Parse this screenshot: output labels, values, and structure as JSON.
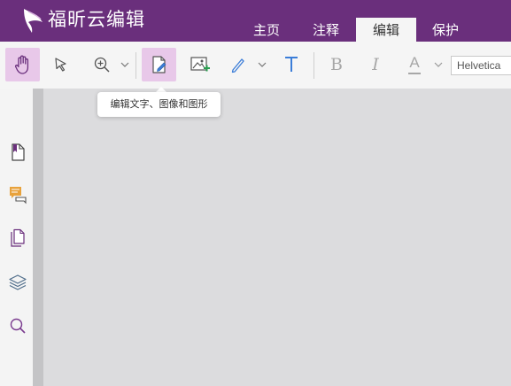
{
  "app": {
    "title": "福昕云编辑"
  },
  "colors": {
    "brand": "#6a2f7c",
    "active": "#e8c8e9",
    "accent_blue": "#3b7dd8"
  },
  "tabs": [
    {
      "label": "主页"
    },
    {
      "label": "注释"
    },
    {
      "label": "编辑",
      "selected": true
    },
    {
      "label": "保护"
    }
  ],
  "toolbar": {
    "tools": [
      {
        "icon": "hand-icon",
        "state": "active"
      },
      {
        "icon": "select-arrow-icon"
      },
      {
        "icon": "zoom-icon"
      },
      {
        "icon": "edit-text-image-icon",
        "state": "active"
      },
      {
        "icon": "insert-image-icon"
      },
      {
        "icon": "pen-icon"
      },
      {
        "icon": "add-text-icon"
      },
      {
        "icon": "bold-icon",
        "label": "B"
      },
      {
        "icon": "italic-icon",
        "label": "I"
      },
      {
        "icon": "font-color-icon",
        "label": "A"
      }
    ],
    "font_name": "Helvetica"
  },
  "tooltip": {
    "text": "编辑文字、图像和图形"
  },
  "sidebar": {
    "items": [
      {
        "icon": "bookmark-icon"
      },
      {
        "icon": "comments-icon"
      },
      {
        "icon": "pages-icon"
      },
      {
        "icon": "layers-icon"
      },
      {
        "icon": "search-icon"
      }
    ]
  }
}
